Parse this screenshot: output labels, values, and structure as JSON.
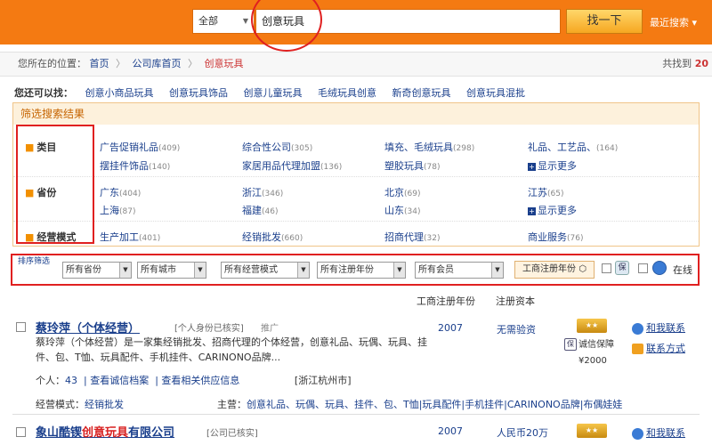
{
  "header": {
    "scope": "全部",
    "search_value": "创意玩具",
    "search_button": "找一下",
    "recent_search": "最近搜索"
  },
  "breadcrumb": {
    "prefix": "您所在的位置：",
    "items": [
      "首页",
      "公司库首页",
      "创意玩具"
    ],
    "found_prefix": "共找到",
    "found_count": "20"
  },
  "suggestions": {
    "label": "您还可以找：",
    "items": [
      "创意小商品玩具",
      "创意玩具饰品",
      "创意儿童玩具",
      "毛绒玩具创意",
      "新奇创意玩具",
      "创意玩具混批"
    ]
  },
  "filter": {
    "title": "筛选搜索结果",
    "more_label": "显示更多",
    "categories": {
      "label": "类目",
      "options": [
        {
          "name": "广告促销礼品",
          "count": "(409)"
        },
        {
          "name": "综合性公司",
          "count": "(305)"
        },
        {
          "name": "填充、毛绒玩具",
          "count": "(298)"
        },
        {
          "name": "礼品、工艺品、",
          "count": "(164)"
        },
        {
          "name": "摆挂件饰品",
          "count": "(140)"
        },
        {
          "name": "家居用品代理加盟",
          "count": "(136)"
        },
        {
          "name": "塑胶玩具",
          "count": "(78)"
        }
      ]
    },
    "provinces": {
      "label": "省份",
      "options": [
        {
          "name": "广东",
          "count": "(404)"
        },
        {
          "name": "浙江",
          "count": "(346)"
        },
        {
          "name": "北京",
          "count": "(69)"
        },
        {
          "name": "江苏",
          "count": "(65)"
        },
        {
          "name": "上海",
          "count": "(87)"
        },
        {
          "name": "福建",
          "count": "(46)"
        },
        {
          "name": "山东",
          "count": "(34)"
        }
      ]
    },
    "business_mode": {
      "label": "经营模式",
      "options": [
        {
          "name": "生产加工",
          "count": "(401)"
        },
        {
          "name": "经销批发",
          "count": "(660)"
        },
        {
          "name": "招商代理",
          "count": "(32)"
        },
        {
          "name": "商业服务",
          "count": "(76)"
        }
      ]
    }
  },
  "dropdown_bar": {
    "title": "排序筛选",
    "selects": [
      "所有省份",
      "所有城市",
      "所有经营模式",
      "所有注册年份",
      "所有会员"
    ],
    "year_button": "工商注册年份",
    "online_label": "在线"
  },
  "columns": {
    "reg_year": "工商注册年份",
    "reg_capital": "注册资本"
  },
  "results": [
    {
      "name": "蔡玲萍（个体经营）",
      "verify_tag": "[个人身份已核实]",
      "promo_tag": "推广",
      "desc": "蔡玲萍（个体经营）是一家集经销批发、招商代理的个体经营，创意礼品、玩偶、玩具、挂件、包、T恤、玩具配件、手机挂件、CARINONO品牌...",
      "people_label": "个人：",
      "people": "43",
      "link1": "查看诚信档案",
      "link2": "查看相关供应信息",
      "location": "[浙江杭州市]",
      "mode_label": "经营模式：",
      "mode": "经销批发",
      "main_label": "主营：",
      "main": "创意礼品、玩偶、玩具、挂件、包、T恤|玩具配件|手机挂件|CARINONO品牌|布偶娃娃",
      "year": "2007",
      "capital": "无需验资",
      "guarantee": "诚信保障",
      "guarantee_amount": "¥2000",
      "contact1": "和我联系",
      "contact2": "联系方式"
    },
    {
      "name_pre": "象山酷锲",
      "name_hl": "创意玩具",
      "name_post": "有限公司",
      "verify_tag": "[公司已核实]",
      "year": "2007",
      "capital": "人民币20万",
      "contact1": "和我联系"
    }
  ]
}
